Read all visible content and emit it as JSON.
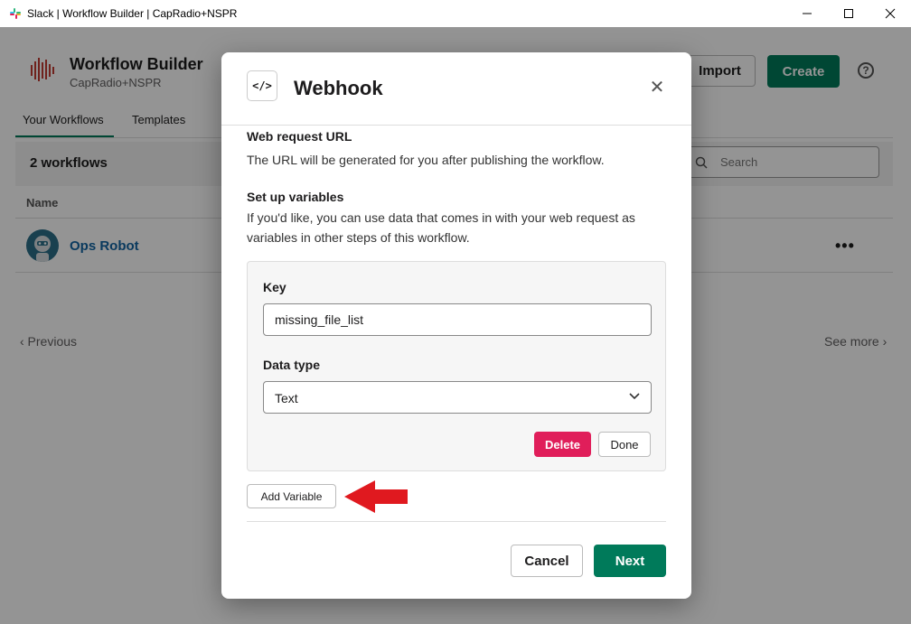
{
  "window": {
    "title": "Slack | Workflow Builder | CapRadio+NSPR",
    "controls": [
      "minimize-icon",
      "maximize-icon",
      "close-icon"
    ]
  },
  "header": {
    "title": "Workflow Builder",
    "subtitle": "CapRadio+NSPR",
    "import_label": "Import",
    "create_label": "Create",
    "help_glyph": "?"
  },
  "tabs": [
    {
      "label": "Your Workflows",
      "active": true
    },
    {
      "label": "Templates",
      "active": false
    }
  ],
  "list": {
    "count_label": "2 workflows",
    "search_placeholder": "Search",
    "column_name": "Name",
    "rows": [
      {
        "name": "Ops Robot",
        "more": "•••"
      }
    ]
  },
  "pagination": {
    "previous": "‹ Previous",
    "see_more": "See more ›"
  },
  "modal": {
    "icon_glyph": "</>",
    "title": "Webhook",
    "close_glyph": "✕",
    "web_request_heading": "Web request URL",
    "web_request_text": "The URL will be generated for you after publishing the workflow.",
    "variables_heading": "Set up variables",
    "variables_text": "If you'd like, you can use data that comes in with your web request as variables in other steps of this workflow.",
    "variable": {
      "key_label": "Key",
      "key_value": "missing_file_list",
      "type_label": "Data type",
      "type_value": "Text",
      "delete_label": "Delete",
      "done_label": "Done"
    },
    "add_variable_label": "Add Variable",
    "cancel_label": "Cancel",
    "next_label": "Next"
  },
  "colors": {
    "primary_green": "#007a5a",
    "delete_red": "#e01e5a",
    "link_blue": "#1264a3",
    "annotation_arrow": "#e0191f"
  }
}
